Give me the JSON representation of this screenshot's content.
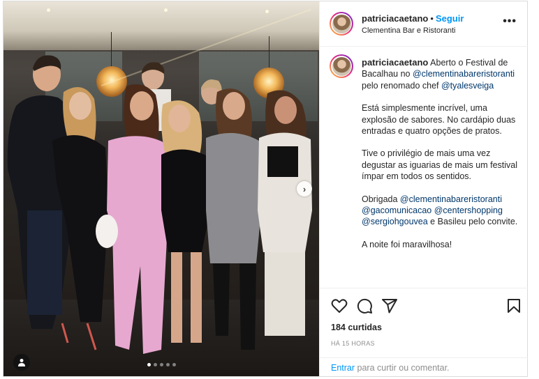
{
  "post": {
    "author": "patriciacaetano",
    "separator": "•",
    "follow_label": "Seguir",
    "location": "Clementina Bar e Ristoranti",
    "more_label": "•••",
    "caption_parts": [
      {
        "text": "Aberto o Festival de Bacalhau no ",
        "type": "text"
      },
      {
        "text": "@clementinabareristoranti",
        "type": "mention"
      },
      {
        "text": " pelo renomado chef ",
        "type": "text"
      },
      {
        "text": "@tyalesveiga",
        "type": "mention"
      }
    ],
    "paragraph2": "Está simplesmente incrível, uma explosão de sabores. No cardápio duas entradas e quatro opções de pratos.",
    "paragraph3": "Tive o privilégio de mais uma vez degustar as iguarias de mais um festival ímpar em todos os sentidos.",
    "paragraph4_parts": [
      {
        "text": "Obrigada ",
        "type": "text"
      },
      {
        "text": "@clementinabareristoranti",
        "type": "mention"
      },
      {
        "text": " ",
        "type": "text"
      },
      {
        "text": "@gacomunicacao",
        "type": "mention"
      },
      {
        "text": " ",
        "type": "text"
      },
      {
        "text": "@centershopping",
        "type": "mention"
      },
      {
        "text": " ",
        "type": "text"
      },
      {
        "text": "@sergiohgouvea",
        "type": "mention"
      },
      {
        "text": " e Basileu pelo convite.",
        "type": "text"
      }
    ],
    "paragraph5": "A noite foi maravilhosa!",
    "likes": "184 curtidas",
    "time": "HÁ 15 HORAS",
    "comment_login": "Entrar",
    "comment_rest": " para curtir ou comentar.",
    "carousel": {
      "count": 5,
      "active": 0,
      "next_icon": "chevron-right-icon"
    },
    "icons": [
      "heart-icon",
      "comment-icon",
      "share-icon",
      "bookmark-icon",
      "user-tag-icon",
      "more-icon"
    ],
    "colors": {
      "link": "#0095f6",
      "mention": "#00376b",
      "muted": "#8e8e8e",
      "text": "#262626"
    }
  }
}
